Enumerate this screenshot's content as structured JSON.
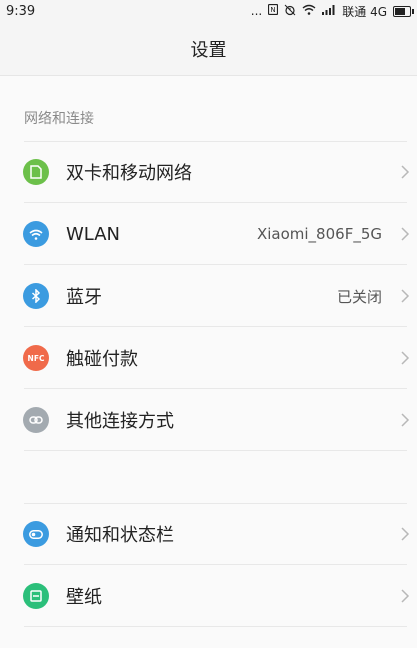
{
  "status_bar": {
    "time": "9:39",
    "carrier": "联通 4G",
    "dots": "..."
  },
  "title": "设置",
  "section_header": "网络和连接",
  "network_items": [
    {
      "label": "双卡和移动网络",
      "value": "",
      "icon": "sim-card-icon",
      "color": "#6cc04a"
    },
    {
      "label": "WLAN",
      "value": "Xiaomi_806F_5G",
      "icon": "wifi-icon",
      "color": "#3b9be0"
    },
    {
      "label": "蓝牙",
      "value": "已关闭",
      "icon": "bluetooth-icon",
      "color": "#3b9be0"
    },
    {
      "label": "触碰付款",
      "value": "",
      "icon": "nfc-icon",
      "color": "#f06a4a"
    },
    {
      "label": "其他连接方式",
      "value": "",
      "icon": "link-icon",
      "color": "#a3aab0"
    }
  ],
  "other_items": [
    {
      "label": "通知和状态栏",
      "icon": "notification-toggle-icon",
      "color": "#3b9be0"
    },
    {
      "label": "壁纸",
      "icon": "wallpaper-icon",
      "color": "#2bbf7a"
    }
  ],
  "colors": {
    "background": "#fafafa",
    "divider": "#e8e8e8",
    "section_text": "#8a8a8a"
  }
}
